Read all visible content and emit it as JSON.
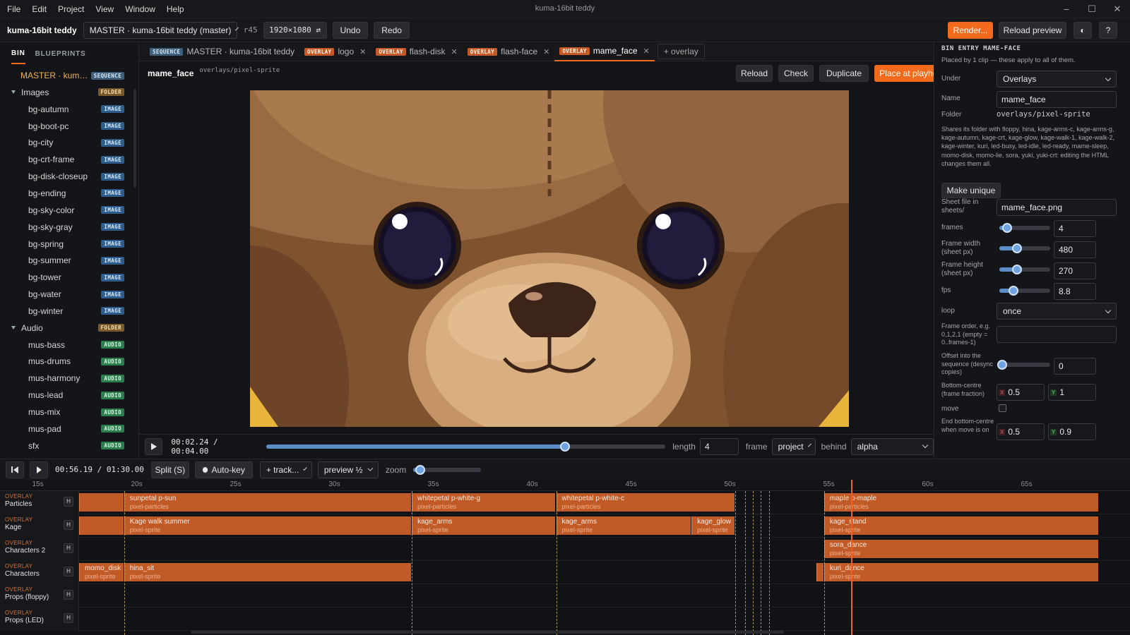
{
  "menu": [
    "File",
    "Edit",
    "Project",
    "View",
    "Window",
    "Help"
  ],
  "window_title": "kuma-16bit teddy",
  "toolbar": {
    "project_name": "kuma-16bit teddy",
    "sequence_select": "MASTER · kuma-16bit teddy (master)",
    "revision": "r45",
    "resolution": "1920×1080 ⇄",
    "undo": "Undo",
    "redo": "Redo",
    "render": "Render...",
    "reload_preview": "Reload preview",
    "theme": "◐",
    "help": "?"
  },
  "bin": {
    "tabs": [
      "BIN",
      "BLUEPRINTS"
    ],
    "items": [
      {
        "name": "MASTER · kuma...",
        "tag": "SEQUENCE",
        "kind": "seq",
        "indent": 0
      },
      {
        "name": "Images",
        "tag": "FOLDER",
        "kind": "fold",
        "indent": 0
      },
      {
        "name": "bg-autumn",
        "tag": "IMAGE",
        "kind": "img",
        "indent": 1
      },
      {
        "name": "bg-boot-pc",
        "tag": "IMAGE",
        "kind": "img",
        "indent": 1
      },
      {
        "name": "bg-city",
        "tag": "IMAGE",
        "kind": "img",
        "indent": 1
      },
      {
        "name": "bg-crt-frame",
        "tag": "IMAGE",
        "kind": "img",
        "indent": 1
      },
      {
        "name": "bg-disk-closeup",
        "tag": "IMAGE",
        "kind": "img",
        "indent": 1
      },
      {
        "name": "bg-ending",
        "tag": "IMAGE",
        "kind": "img",
        "indent": 1
      },
      {
        "name": "bg-sky-color",
        "tag": "IMAGE",
        "kind": "img",
        "indent": 1
      },
      {
        "name": "bg-sky-gray",
        "tag": "IMAGE",
        "kind": "img",
        "indent": 1
      },
      {
        "name": "bg-spring",
        "tag": "IMAGE",
        "kind": "img",
        "indent": 1
      },
      {
        "name": "bg-summer",
        "tag": "IMAGE",
        "kind": "img",
        "indent": 1
      },
      {
        "name": "bg-tower",
        "tag": "IMAGE",
        "kind": "img",
        "indent": 1
      },
      {
        "name": "bg-water",
        "tag": "IMAGE",
        "kind": "img",
        "indent": 1
      },
      {
        "name": "bg-winter",
        "tag": "IMAGE",
        "kind": "img",
        "indent": 1
      },
      {
        "name": "Audio",
        "tag": "FOLDER",
        "kind": "fold",
        "indent": 0
      },
      {
        "name": "mus-bass",
        "tag": "AUDIO",
        "kind": "aud",
        "indent": 1
      },
      {
        "name": "mus-drums",
        "tag": "AUDIO",
        "kind": "aud",
        "indent": 1
      },
      {
        "name": "mus-harmony",
        "tag": "AUDIO",
        "kind": "aud",
        "indent": 1
      },
      {
        "name": "mus-lead",
        "tag": "AUDIO",
        "kind": "aud",
        "indent": 1
      },
      {
        "name": "mus-mix",
        "tag": "AUDIO",
        "kind": "aud",
        "indent": 1
      },
      {
        "name": "mus-pad",
        "tag": "AUDIO",
        "kind": "aud",
        "indent": 1
      },
      {
        "name": "sfx",
        "tag": "AUDIO",
        "kind": "aud",
        "indent": 1
      }
    ]
  },
  "doc_tabs": [
    {
      "tag": "SEQUENCE",
      "kind": "seq",
      "label": "MASTER · kuma-16bit teddy",
      "closable": false,
      "active": false
    },
    {
      "tag": "OVERLAY",
      "kind": "ovl",
      "label": "logo",
      "closable": true,
      "active": false
    },
    {
      "tag": "OVERLAY",
      "kind": "ovl",
      "label": "flash-disk",
      "closable": true,
      "active": false
    },
    {
      "tag": "OVERLAY",
      "kind": "ovl",
      "label": "flash-face",
      "closable": true,
      "active": false
    },
    {
      "tag": "OVERLAY",
      "kind": "ovl",
      "label": "mame_face",
      "closable": true,
      "active": true
    }
  ],
  "add_overlay": "+ overlay",
  "entry": {
    "name": "mame_face",
    "path": "overlays/pixel-sprite",
    "reload": "Reload",
    "check": "Check",
    "duplicate": "Duplicate",
    "place": "Place at playhead"
  },
  "transport": {
    "time": "00:02.24 / 00:04.00",
    "progress": 0.73,
    "length_label": "length",
    "length_value": "4",
    "frame_label": "frame",
    "frame_select": "project",
    "behind_label": "behind",
    "behind_select": "alpha"
  },
  "inspector": {
    "heading": "BIN ENTRY MAME-FACE",
    "sub": "Placed by 1 clip — these apply to all of them.",
    "under_label": "Under",
    "under_value": "Overlays",
    "name_label": "Name",
    "name_value": "mame_face",
    "folder_label": "Folder",
    "folder_value": "overlays/pixel-sprite",
    "shares_text": "Shares its folder with floppy, hina, kage-arms-c, kage-arms-g, kage-autumn, kage-crt, kage-glow, kage-walk-1, kage-walk-2, kage-winter, kuri, led-busy, led-idle, led-ready, mame-sleep, momo-disk, momo-lie, sora, yuki, yuki-crt: editing the HTML changes them all.",
    "make_unique": "Make unique",
    "sheet_label": "Sheet file in sheets/",
    "sheet_value": "mame_face.png",
    "frames_label": "frames",
    "frames_value": "4",
    "fw_label": "Frame width (sheet px)",
    "fw_value": "480",
    "fh_label": "Frame height (sheet px)",
    "fh_value": "270",
    "fps_label": "fps",
    "fps_value": "8.8",
    "loop_label": "loop",
    "loop_value": "once",
    "order_label": "Frame order, e.g. 0,1,2,1 (empty = 0..frames-1)",
    "order_value": "",
    "offset_label": "Offset into the sequence (desync copies)",
    "offset_value": "0",
    "bc_label": "Bottom-centre (frame fraction)",
    "bc_x": "0.5",
    "bc_y": "1",
    "move_label": "move",
    "ebc_label": "End bottom-centre when move is on",
    "ebc_x": "0.5",
    "ebc_y": "0.9",
    "x_tag": "X",
    "y_tag": "Y",
    "slider_levels": {
      "frames": 0.15,
      "fw": 0.35,
      "fh": 0.35,
      "fps": 0.28,
      "offset": 0.05
    }
  },
  "timeline_bar": {
    "time": "00:56.19 / 01:30.00",
    "split": "Split (S)",
    "autokey": "Auto-key",
    "track_select": "+ track...",
    "preview_select": "preview ½",
    "zoom_label": "zoom",
    "zoom_level": 0.1
  },
  "ruler": [
    "15s",
    "20s",
    "25s",
    "30s",
    "35s",
    "40s",
    "45s",
    "50s",
    "55s",
    "60s",
    "65s"
  ],
  "tracks": [
    {
      "kind": "OVERLAY",
      "name": "Particles",
      "clips": [
        {
          "name": "",
          "sub": "",
          "s": 14.1,
          "e": 19.4
        },
        {
          "name": "sunpetal p-sun",
          "sub": "pixel-particles",
          "s": 19.4,
          "e": 33.95
        },
        {
          "name": "whitepetal p-white-g",
          "sub": "pixel-particles",
          "s": 33.95,
          "e": 41.25
        },
        {
          "name": "whitepetal p-white-c",
          "sub": "pixel-particles",
          "s": 41.25,
          "e": 50.3
        },
        {
          "name": "maple p-maple",
          "sub": "pixel-particles",
          "s": 54.8,
          "e": 68.7
        }
      ]
    },
    {
      "kind": "OVERLAY",
      "name": "Kage",
      "clips": [
        {
          "name": "",
          "sub": "",
          "s": 14.1,
          "e": 19.4
        },
        {
          "name": "Kage walk summer",
          "sub": "pixel-sprite",
          "s": 19.4,
          "e": 33.95
        },
        {
          "name": "kage_arms",
          "sub": "pixel-sprite",
          "s": 33.95,
          "e": 41.25
        },
        {
          "name": "kage_arms",
          "sub": "pixel-sprite",
          "s": 41.25,
          "e": 48.1
        },
        {
          "name": "kage_glow",
          "sub": "pixel-sprite",
          "s": 48.1,
          "e": 50.3
        },
        {
          "name": "kage_stand",
          "sub": "pixel-sprite",
          "s": 54.8,
          "e": 68.7
        }
      ]
    },
    {
      "kind": "OVERLAY",
      "name": "Characters 2",
      "clips": [
        {
          "name": "sora_dance",
          "sub": "pixel-sprite",
          "s": 54.8,
          "e": 68.7
        }
      ]
    },
    {
      "kind": "OVERLAY",
      "name": "Characters",
      "clips": [
        {
          "name": "",
          "sub": "",
          "s": 14.1,
          "e": 15.7
        },
        {
          "name": "momo_disk",
          "sub": "pixel-sprite",
          "s": 15.7,
          "e": 19.4
        },
        {
          "name": "hina_sit",
          "sub": "pixel-sprite",
          "s": 19.4,
          "e": 33.95
        },
        {
          "name": "",
          "sub": "",
          "s": 54.4,
          "e": 54.8
        },
        {
          "name": "kuri_dance",
          "sub": "pixel-sprite",
          "s": 54.8,
          "e": 68.7
        }
      ]
    },
    {
      "kind": "OVERLAY",
      "name": "Props (floppy)",
      "clips": []
    },
    {
      "kind": "OVERLAY",
      "name": "Props (LED)",
      "clips": []
    }
  ],
  "markers": [
    19.4,
    33.95,
    41.25,
    50.3,
    50.8,
    51.2,
    51.6,
    52.0,
    54.8
  ],
  "playhead_s": 56.19,
  "hide_btn": "H",
  "colors": {
    "accent": "#f26a1b",
    "clip": "#c05a27",
    "playhead": "#ff5a1a"
  }
}
